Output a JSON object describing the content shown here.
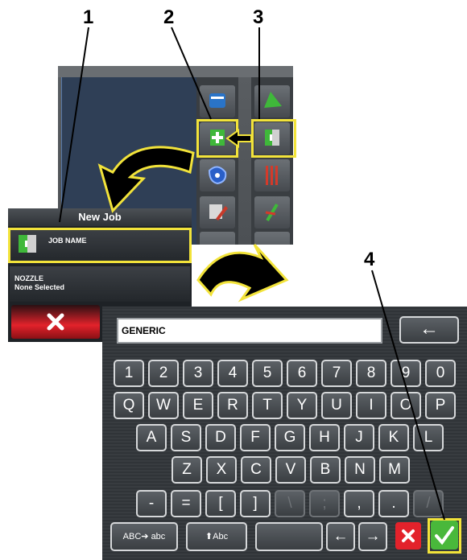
{
  "callouts": [
    "1",
    "2",
    "3",
    "4"
  ],
  "dialog": {
    "title": "New Job",
    "job_name_label": "JOB NAME",
    "nozzle_label": "NOZZLE",
    "nozzle_value": "None Selected"
  },
  "keyboard": {
    "input_value": "GENERIC",
    "row1": [
      "1",
      "2",
      "3",
      "4",
      "5",
      "6",
      "7",
      "8",
      "9",
      "0"
    ],
    "row2": [
      "Q",
      "W",
      "E",
      "R",
      "T",
      "Y",
      "U",
      "I",
      "O",
      "P"
    ],
    "row3": [
      "A",
      "S",
      "D",
      "F",
      "G",
      "H",
      "J",
      "K",
      "L"
    ],
    "row4": [
      "Z",
      "X",
      "C",
      "V",
      "B",
      "N",
      "M"
    ],
    "row5": [
      "-",
      "=",
      "[",
      "]",
      "\\",
      ";",
      ",",
      ".",
      "/"
    ],
    "abc_toggle": "ABC➔ abc",
    "shift_label": "⬆Abc",
    "left_arrow": "←",
    "right_arrow": "→",
    "backspace": "←"
  },
  "colors": {
    "highlight": "#f2e33a",
    "cancel_red": "#e3222b",
    "confirm_green": "#49b83b"
  }
}
